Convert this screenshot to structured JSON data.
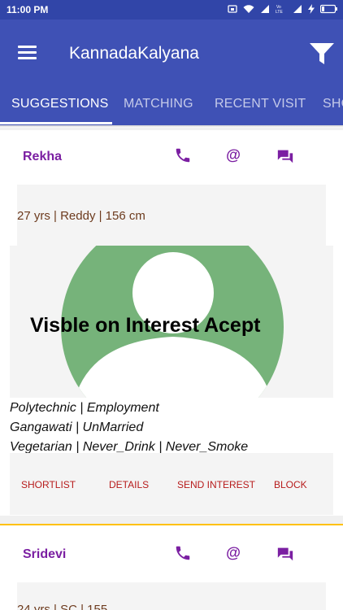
{
  "status_bar": {
    "time": "11:00 PM",
    "icons": [
      "cast-icon",
      "wifi-icon",
      "signal-icon",
      "volte-lte-icon",
      "signal-icon",
      "charging-icon",
      "battery-icon"
    ],
    "volte_text": "Vo LTE"
  },
  "app_bar": {
    "title": "KannadaKalyana",
    "menu_icon": "menu-icon",
    "filter_icon": "filter-icon"
  },
  "tabs": [
    {
      "label": "SUGGESTIONS",
      "active": true
    },
    {
      "label": "MATCHING",
      "active": false
    },
    {
      "label": "RECENT VISIT",
      "active": false
    },
    {
      "label": "SHO",
      "active": false
    }
  ],
  "colors": {
    "primary": "#3f51b5",
    "status_bar": "#3145a8",
    "name": "#7b1fa2",
    "action_text": "#b71c1c",
    "info_text": "#6d3b1e",
    "divider": "#ffc107",
    "avatar": "#76b37a"
  },
  "profiles": [
    {
      "name": "Rekha",
      "summary": "27 yrs | Reddy | 156 cm",
      "photo_overlay": "Visble on Interest Acept",
      "details": [
        "Polytechnic | Employment",
        "Gangawati | UnMarried",
        "Vegetarian | Never_Drink | Never_Smoke"
      ],
      "actions": [
        "SHORTLIST",
        "DETAILS",
        "SEND INTEREST",
        "BLOCK"
      ]
    },
    {
      "name": "Sridevi",
      "summary_partial": "24 yrs | SC | 155"
    }
  ]
}
